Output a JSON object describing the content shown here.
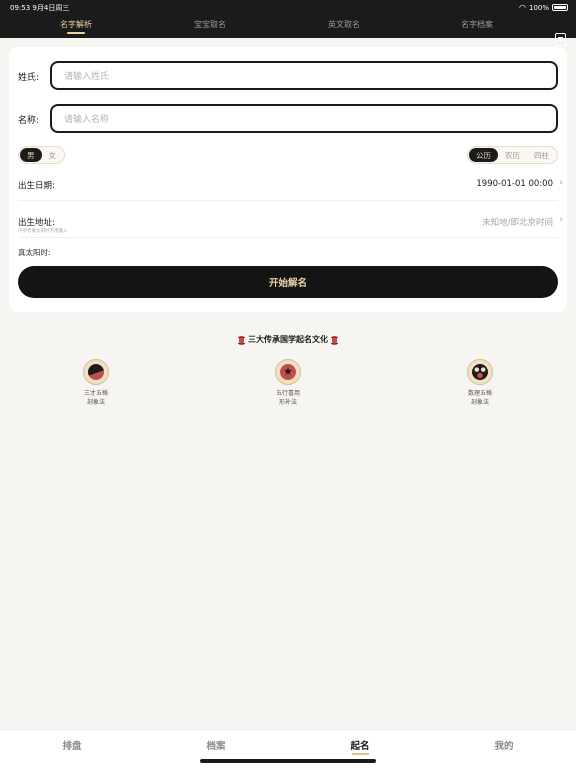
{
  "status": {
    "time": "09:53",
    "date": "9月4日周三",
    "battery": "100%"
  },
  "tabs": [
    {
      "label": "名字解析",
      "active": true
    },
    {
      "label": "宝宝取名",
      "active": false
    },
    {
      "label": "英文取名",
      "active": false
    },
    {
      "label": "名字档案",
      "active": false
    }
  ],
  "form": {
    "surname_label": "姓氏:",
    "surname_placeholder": "请输入姓氏",
    "name_label": "名称:",
    "name_placeholder": "请输入名称",
    "gender": {
      "male": "男",
      "female": "女",
      "selected": "男"
    },
    "calendar": {
      "solar": "公历",
      "lunar": "农历",
      "pillars": "四柱",
      "selected": "公历"
    },
    "birth_date_label": "出生日期:",
    "birth_date_value": "1990-01-01 00:00",
    "birth_place_label": "出生地址:",
    "birth_place_hint": "不参考真太阳时不用输入",
    "birth_place_value": "未知地/即北京时间",
    "solar_time_label": "真太阳时:",
    "submit_label": "开始解名"
  },
  "culture": {
    "title": "三大传承国学起名文化",
    "items": [
      {
        "line1": "三才五格",
        "line2": "剖象法"
      },
      {
        "line1": "五行喜用",
        "line2": "形补法"
      },
      {
        "line1": "数理五格",
        "line2": "剖象法"
      }
    ]
  },
  "bottom_nav": [
    {
      "label": "排盘",
      "active": false
    },
    {
      "label": "档案",
      "active": false
    },
    {
      "label": "起名",
      "active": true
    },
    {
      "label": "我的",
      "active": false
    }
  ],
  "colors": {
    "dark": "#1b1b1b",
    "gold": "#e9d3a3",
    "accent_red": "#c0504d"
  }
}
